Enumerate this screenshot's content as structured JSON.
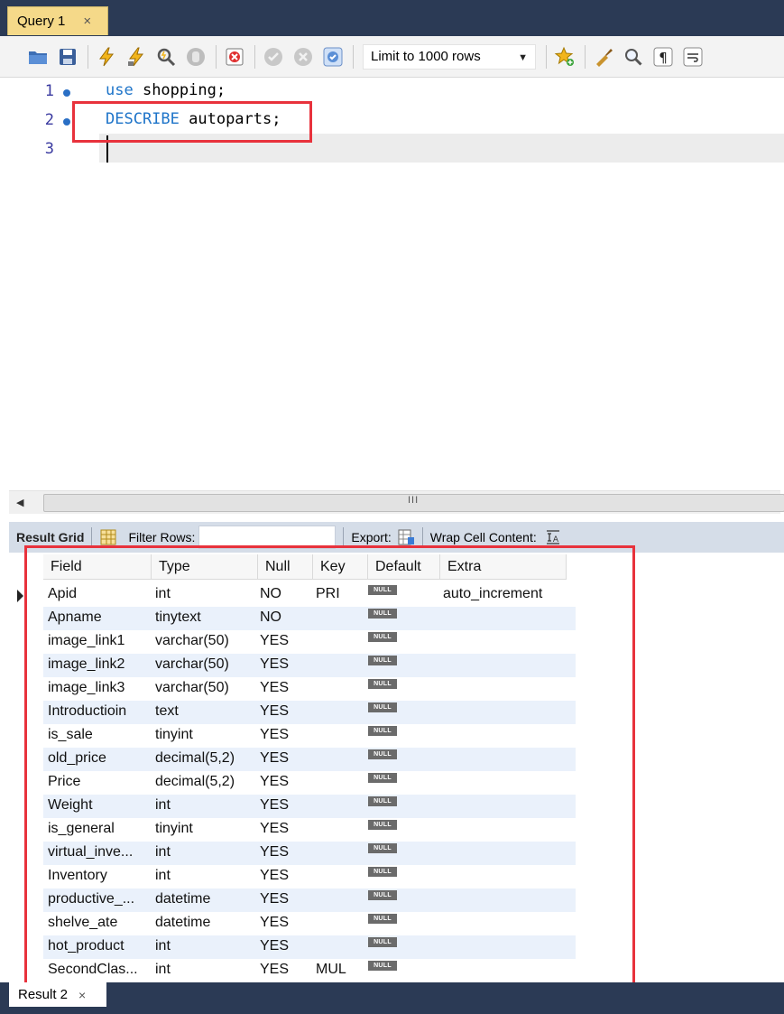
{
  "tabs": {
    "query_tab": {
      "label": "Query 1",
      "close": "×"
    }
  },
  "toolbar": {
    "icons": [
      "open-folder-icon",
      "save-icon",
      "execute-icon",
      "execute-current-icon",
      "explain-icon",
      "stop-icon",
      "toggle-errors-icon",
      "commit-icon",
      "rollback-icon",
      "autocommit-icon",
      "add-snippet-icon",
      "beautify-icon",
      "find-icon",
      "invisible-chars-icon",
      "wrap-icon"
    ],
    "limit_select": {
      "value": "Limit to 1000 rows"
    }
  },
  "editor": {
    "lines": [
      {
        "num": "1",
        "keyword": "use",
        "rest": " shopping;"
      },
      {
        "num": "2",
        "keyword": "DESCRIBE",
        "rest": " autoparts;"
      },
      {
        "num": "3",
        "keyword": "",
        "rest": ""
      }
    ]
  },
  "hscroll": {
    "grip": "III"
  },
  "result_toolbar": {
    "result_grid_label": "Result Grid",
    "filter_rows_label": "Filter Rows:",
    "export_label": "Export:",
    "wrap_label": "Wrap Cell Content:"
  },
  "grid": {
    "columns": [
      "Field",
      "Type",
      "Null",
      "Key",
      "Default",
      "Extra"
    ],
    "null_label": "NULL",
    "rows": [
      {
        "field": "Apid",
        "type": "int",
        "null": "NO",
        "key": "PRI",
        "extra": "auto_increment"
      },
      {
        "field": "Apname",
        "type": "tinytext",
        "null": "NO",
        "key": "",
        "extra": ""
      },
      {
        "field": "image_link1",
        "type": "varchar(50)",
        "null": "YES",
        "key": "",
        "extra": ""
      },
      {
        "field": "image_link2",
        "type": "varchar(50)",
        "null": "YES",
        "key": "",
        "extra": ""
      },
      {
        "field": "image_link3",
        "type": "varchar(50)",
        "null": "YES",
        "key": "",
        "extra": ""
      },
      {
        "field": "Introductioin",
        "type": "text",
        "null": "YES",
        "key": "",
        "extra": ""
      },
      {
        "field": "is_sale",
        "type": "tinyint",
        "null": "YES",
        "key": "",
        "extra": ""
      },
      {
        "field": "old_price",
        "type": "decimal(5,2)",
        "null": "YES",
        "key": "",
        "extra": ""
      },
      {
        "field": "Price",
        "type": "decimal(5,2)",
        "null": "YES",
        "key": "",
        "extra": ""
      },
      {
        "field": "Weight",
        "type": "int",
        "null": "YES",
        "key": "",
        "extra": ""
      },
      {
        "field": "is_general",
        "type": "tinyint",
        "null": "YES",
        "key": "",
        "extra": ""
      },
      {
        "field": "virtual_inve...",
        "type": "int",
        "null": "YES",
        "key": "",
        "extra": ""
      },
      {
        "field": "Inventory",
        "type": "int",
        "null": "YES",
        "key": "",
        "extra": ""
      },
      {
        "field": "productive_...",
        "type": "datetime",
        "null": "YES",
        "key": "",
        "extra": ""
      },
      {
        "field": "shelve_ate",
        "type": "datetime",
        "null": "YES",
        "key": "",
        "extra": ""
      },
      {
        "field": "hot_product",
        "type": "int",
        "null": "YES",
        "key": "",
        "extra": ""
      },
      {
        "field": "SecondClas...",
        "type": "int",
        "null": "YES",
        "key": "MUL",
        "extra": ""
      }
    ]
  },
  "bottom_tabs": {
    "result_tab": {
      "label": "Result 2",
      "close": "×"
    }
  },
  "colors": {
    "highlight": "#e8323c",
    "tabbar": "#2b3a55",
    "active_tab": "#f5d989",
    "keyword": "#1e74c9"
  }
}
